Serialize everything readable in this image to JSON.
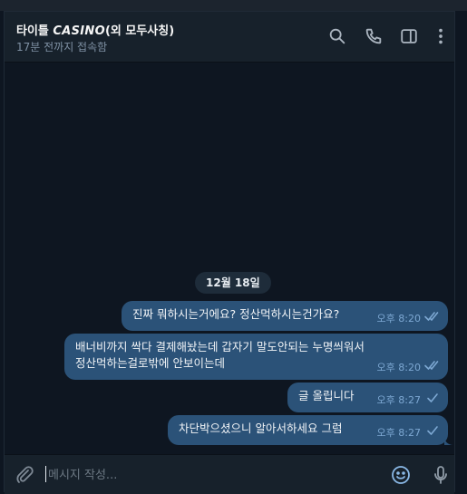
{
  "header": {
    "title_prefix": "타이틀 ",
    "title_brand": "CASINO",
    "title_suffix": "(외 모두사칭)",
    "status": "17분 전까지 접속함"
  },
  "icons": {
    "search": "search-icon",
    "call": "phone-icon",
    "sidebar": "sidebar-toggle-icon",
    "more": "more-vertical-icon",
    "attach": "paperclip-icon",
    "emoji": "emoji-icon",
    "mic": "microphone-icon"
  },
  "chat": {
    "date_label": "12월 18일",
    "messages": [
      {
        "text": "진짜 뭐하시는거에요? 정산먹하시는건가요?",
        "time": "오후 8:20",
        "status": "read"
      },
      {
        "text": "배너비까지 싹다 결제해놨는데 갑자기 말도안되는 누명씌워서\n정산먹하는걸로밖에 안보이는데",
        "time": "오후 8:20",
        "status": "read"
      },
      {
        "text": "글 올립니다",
        "time": "오후 8:27",
        "status": "sent"
      },
      {
        "text": "차단박으셨으니 알아서하세요 그럼",
        "time": "오후 8:27",
        "status": "sent"
      }
    ]
  },
  "composer": {
    "placeholder": "메시지 작성..."
  },
  "colors": {
    "background": "#0e1621",
    "header": "#17212b",
    "bubble_out": "#2b5278",
    "meta": "#7da8d3"
  }
}
